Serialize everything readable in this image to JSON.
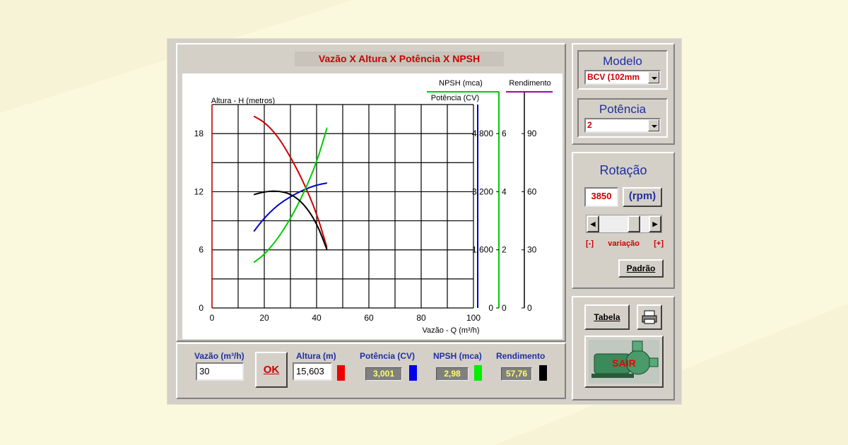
{
  "chart": {
    "title": "Vazão X Altura X Potência X NPSH",
    "label_altura": "Altura - H (metros)",
    "label_vazao": "Vazão - Q (m³/h)",
    "label_npsh": "NPSH (mca)",
    "label_potencia": "Potência (CV)",
    "label_rendimento": "Rendimento"
  },
  "chart_data": {
    "type": "line",
    "xlabel": "Vazão - Q (m³/h)",
    "ylabel": "Altura - H (metros)",
    "xlim": [
      0,
      100
    ],
    "ylim": [
      0,
      21
    ],
    "x_ticks": [
      "0",
      "20",
      "40",
      "60",
      "80",
      "100"
    ],
    "y_ticks": [
      "0",
      "6",
      "12",
      "18"
    ],
    "potencia_ticks": [
      "0",
      "1,600",
      "3,200",
      "4,800"
    ],
    "npsh_ticks": [
      "0",
      "2",
      "4",
      "6"
    ],
    "rendimento_ticks": [
      "0",
      "30",
      "60",
      "90"
    ],
    "grid": true,
    "series": [
      {
        "name": "Altura (m)",
        "color": "#cc0000",
        "x": [
          16,
          20,
          25,
          30,
          35,
          40,
          44
        ],
        "y": [
          19.8,
          19.2,
          17.8,
          15.6,
          13.0,
          9.8,
          6.2
        ]
      },
      {
        "name": "Potência (CV)",
        "color": "#0000cc",
        "x": [
          16,
          20,
          25,
          30,
          35,
          40,
          44
        ],
        "y": [
          7.9,
          9.3,
          10.6,
          11.5,
          12.2,
          12.7,
          12.9
        ]
      },
      {
        "name": "NPSH (mca)",
        "color": "#00cc00",
        "x": [
          16,
          20,
          25,
          30,
          35,
          40,
          44
        ],
        "y": [
          4.7,
          5.5,
          7.1,
          9.2,
          11.8,
          15.0,
          18.6
        ]
      },
      {
        "name": "Rendimento",
        "color": "#000000",
        "x": [
          16,
          20,
          25,
          30,
          35,
          40,
          44
        ],
        "y": [
          11.7,
          12.0,
          12.1,
          11.8,
          10.8,
          8.8,
          6.0
        ]
      }
    ]
  },
  "readouts": {
    "vazao_label": "Vazão (m³/h)",
    "vazao_value": "30",
    "ok_label": "OK",
    "altura_label": "Altura (m)",
    "altura_value": "15,603",
    "potencia_label": "Potência (CV)",
    "potencia_value": "3,001",
    "npsh_label": "NPSH (mca)",
    "npsh_value": "2,98",
    "rendimento_label": "Rendimento",
    "rendimento_value": "57,76"
  },
  "colors": {
    "altura": "#ee0000",
    "potencia": "#0000ee",
    "npsh": "#00ee00",
    "rendimento": "#000000"
  },
  "sidebar": {
    "modelo_title": "Modelo",
    "modelo_value": "BCV (102mm",
    "potencia_title": "Potência",
    "potencia_value": "2",
    "rotacao_title": "Rotação",
    "rotacao_value": "3850",
    "rotacao_unit": "(rpm)",
    "variacao_minus": "[-]",
    "variacao_label": "variação",
    "variacao_plus": "[+]",
    "padrao_button": "Padrão",
    "tabela_button": "Tabela",
    "sair_button": "SAIR"
  }
}
